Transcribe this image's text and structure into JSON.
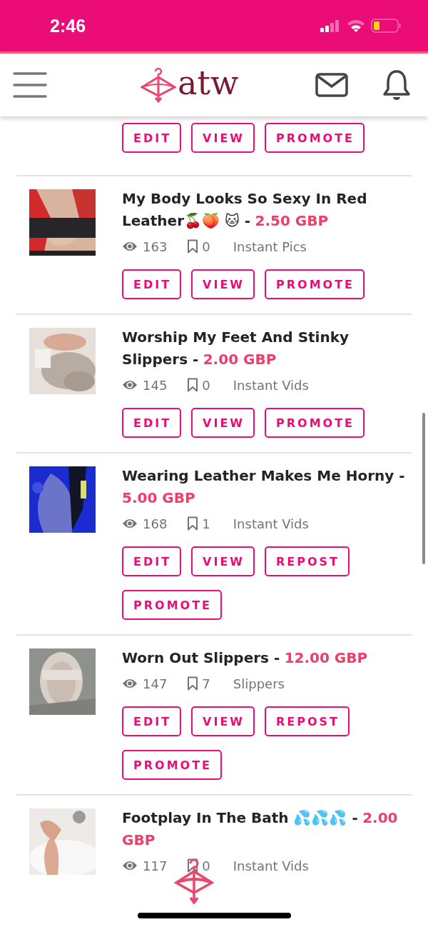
{
  "status_bar": {
    "time": "2:46"
  },
  "header": {
    "logo": "atw"
  },
  "listings": [
    {
      "partial": true,
      "buttons": [
        "EDIT",
        "VIEW",
        "PROMOTE"
      ]
    },
    {
      "title": "My Body Looks So Sexy In Red Leather🍒🍑 🐱 -",
      "price": "2.50 GBP",
      "views": "163",
      "saves": "0",
      "category": "Instant Pics",
      "buttons": [
        "EDIT",
        "VIEW",
        "PROMOTE"
      ]
    },
    {
      "title": "Worship My Feet And Stinky Slippers -",
      "price": "2.00 GBP",
      "views": "145",
      "saves": "0",
      "category": "Instant Vids",
      "buttons": [
        "EDIT",
        "VIEW",
        "PROMOTE"
      ]
    },
    {
      "title": "Wearing Leather Makes Me Horny -",
      "price": "5.00 GBP",
      "views": "168",
      "saves": "1",
      "category": "Instant Vids",
      "buttons": [
        "EDIT",
        "VIEW",
        "REPOST",
        "PROMOTE"
      ]
    },
    {
      "title": "Worn Out Slippers -",
      "price": "12.00 GBP",
      "views": "147",
      "saves": "7",
      "category": "Slippers",
      "buttons": [
        "EDIT",
        "VIEW",
        "REPOST",
        "PROMOTE"
      ]
    },
    {
      "title": "Footplay In The Bath 💦💦💦 -",
      "price": "2.00 GBP",
      "views": "117",
      "saves": "0",
      "category": "Instant Vids"
    }
  ]
}
